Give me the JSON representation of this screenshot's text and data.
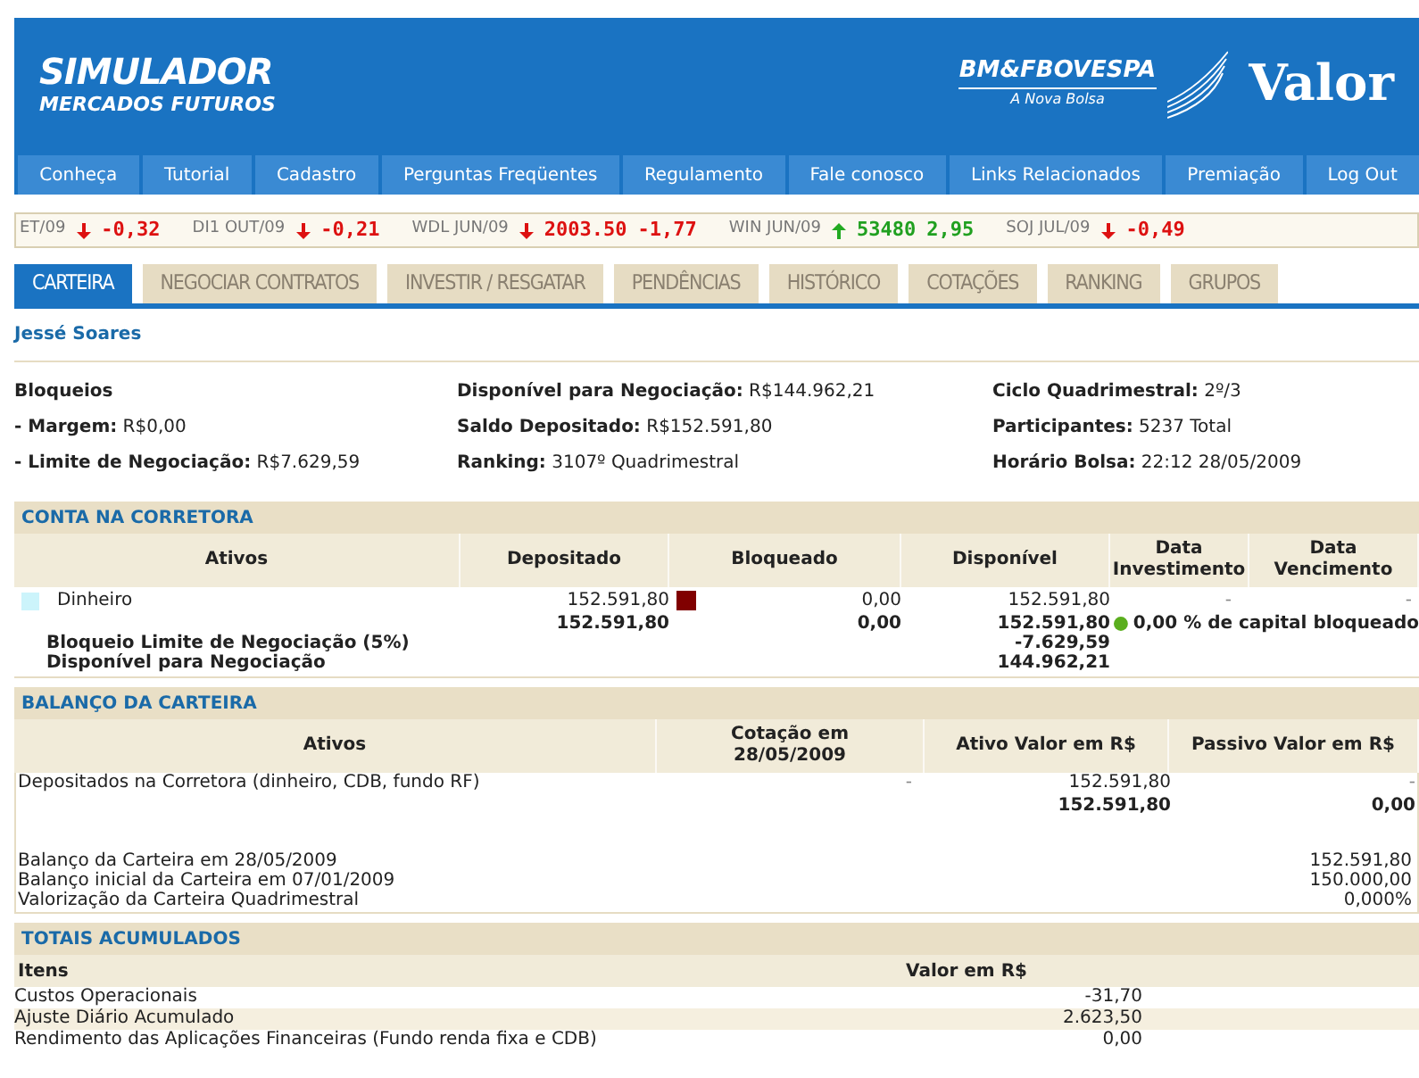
{
  "header": {
    "title": "SIMULADOR",
    "subtitle": "MERCADOS FUTUROS",
    "partner_logo": "BM&FBOVESPA",
    "partner_tagline": "A Nova Bolsa",
    "sponsor_logo": "Valor"
  },
  "nav": [
    "Conheça",
    "Tutorial",
    "Cadastro",
    "Perguntas Freqüentes",
    "Regulamento",
    "Fale conosco",
    "Links Relacionados",
    "Premiação",
    "Log Out"
  ],
  "ticker": [
    {
      "symbol": "ET/09",
      "rising": false,
      "change": "-0,32"
    },
    {
      "symbol": "DI1 OUT/09",
      "rising": false,
      "change": "-0,21"
    },
    {
      "symbol": "WDL JUN/09",
      "rising": false,
      "price": "2003.50",
      "change": "-1,77"
    },
    {
      "symbol": "WIN JUN/09",
      "rising": true,
      "price": "53480",
      "change": "2,95"
    },
    {
      "symbol": "SOJ JUL/09",
      "rising": false,
      "change": "-0,49"
    }
  ],
  "tabs": [
    {
      "label": "CARTEIRA",
      "selected": true
    },
    {
      "label": "NEGOCIAR CONTRATOS",
      "selected": false
    },
    {
      "label": "INVESTIR / RESGATAR",
      "selected": false
    },
    {
      "label": "PENDÊNCIAS",
      "selected": false
    },
    {
      "label": "HISTÓRICO",
      "selected": false
    },
    {
      "label": "COTAÇÕES",
      "selected": false
    },
    {
      "label": "RANKING",
      "selected": false
    },
    {
      "label": "GRUPOS",
      "selected": false
    }
  ],
  "user_name": "Jessé Soares",
  "summary": [
    [
      {
        "label": "Bloqueios"
      },
      {
        "label": "- Margem:",
        "value": "R$0,00"
      },
      {
        "label": "- Limite de Negociação:",
        "value": "R$7.629,59"
      }
    ],
    [
      {
        "label": "Disponível para Negociação:",
        "value": "R$144.962,21"
      },
      {
        "label": "Saldo Depositado:",
        "value": "R$152.591,80"
      },
      {
        "label": "Ranking:",
        "value": "3107º Quadrimestral"
      }
    ],
    [
      {
        "label": "Ciclo Quadrimestral:",
        "value": "2º/3"
      },
      {
        "label": "Participantes:",
        "value": "5237 Total"
      },
      {
        "label": "Horário Bolsa:",
        "value": "22:12 28/05/2009"
      }
    ]
  ],
  "conta": {
    "title": "CONTA NA CORRETORA",
    "columns": [
      "Ativos",
      "Depositado",
      "Bloqueado",
      "Disponível",
      "Data Investimento",
      "Data Vencimento"
    ],
    "rows": [
      {
        "name": "Dinheiro",
        "color": "#ccf4fb",
        "depositado": "152.591,80",
        "bloqueado": "0,00",
        "disponivel": "152.591,80",
        "data_investimento": "-",
        "data_vencimento": "-"
      }
    ],
    "totals": {
      "depositado": "152.591,80",
      "bloqueado": "0,00",
      "disponivel": "152.591,80",
      "blocked_note": "0,00 % de capital bloqueado"
    },
    "extra_rows": [
      {
        "label": "Bloqueio Limite de Negociação (5%)",
        "value": "-7.629,59"
      },
      {
        "label": "Disponível para Negociação",
        "value": "144.962,21"
      }
    ]
  },
  "balanco": {
    "title": "BALANÇO DA CARTEIRA",
    "columns": [
      "Ativos",
      "Cotação em 28/05/2009",
      "Ativo Valor em R$",
      "Passivo Valor em R$"
    ],
    "rows": [
      {
        "name": "Depositados na Corretora (dinheiro, CDB, fundo RF)",
        "cotacao": "-",
        "ativo": "152.591,80",
        "passivo": "-"
      }
    ],
    "totals": {
      "ativo": "152.591,80",
      "passivo": "0,00"
    },
    "summary": [
      {
        "label": "Balanço da Carteira em 28/05/2009",
        "value": "152.591,80"
      },
      {
        "label": "Balanço inicial da Carteira em 07/01/2009",
        "value": "150.000,00"
      },
      {
        "label": "Valorização da Carteira Quadrimestral",
        "value": "0,000%"
      }
    ]
  },
  "totais": {
    "title": "TOTAIS ACUMULADOS",
    "columns": [
      "Itens",
      "Valor em R$"
    ],
    "rows": [
      {
        "item": "Custos Operacionais",
        "value": "-31,70"
      },
      {
        "item": "Ajuste Diário Acumulado",
        "value": "2.623,50"
      },
      {
        "item": "Rendimento das Aplicações Financeiras (Fundo renda fixa e CDB)",
        "value": "0,00"
      }
    ]
  }
}
